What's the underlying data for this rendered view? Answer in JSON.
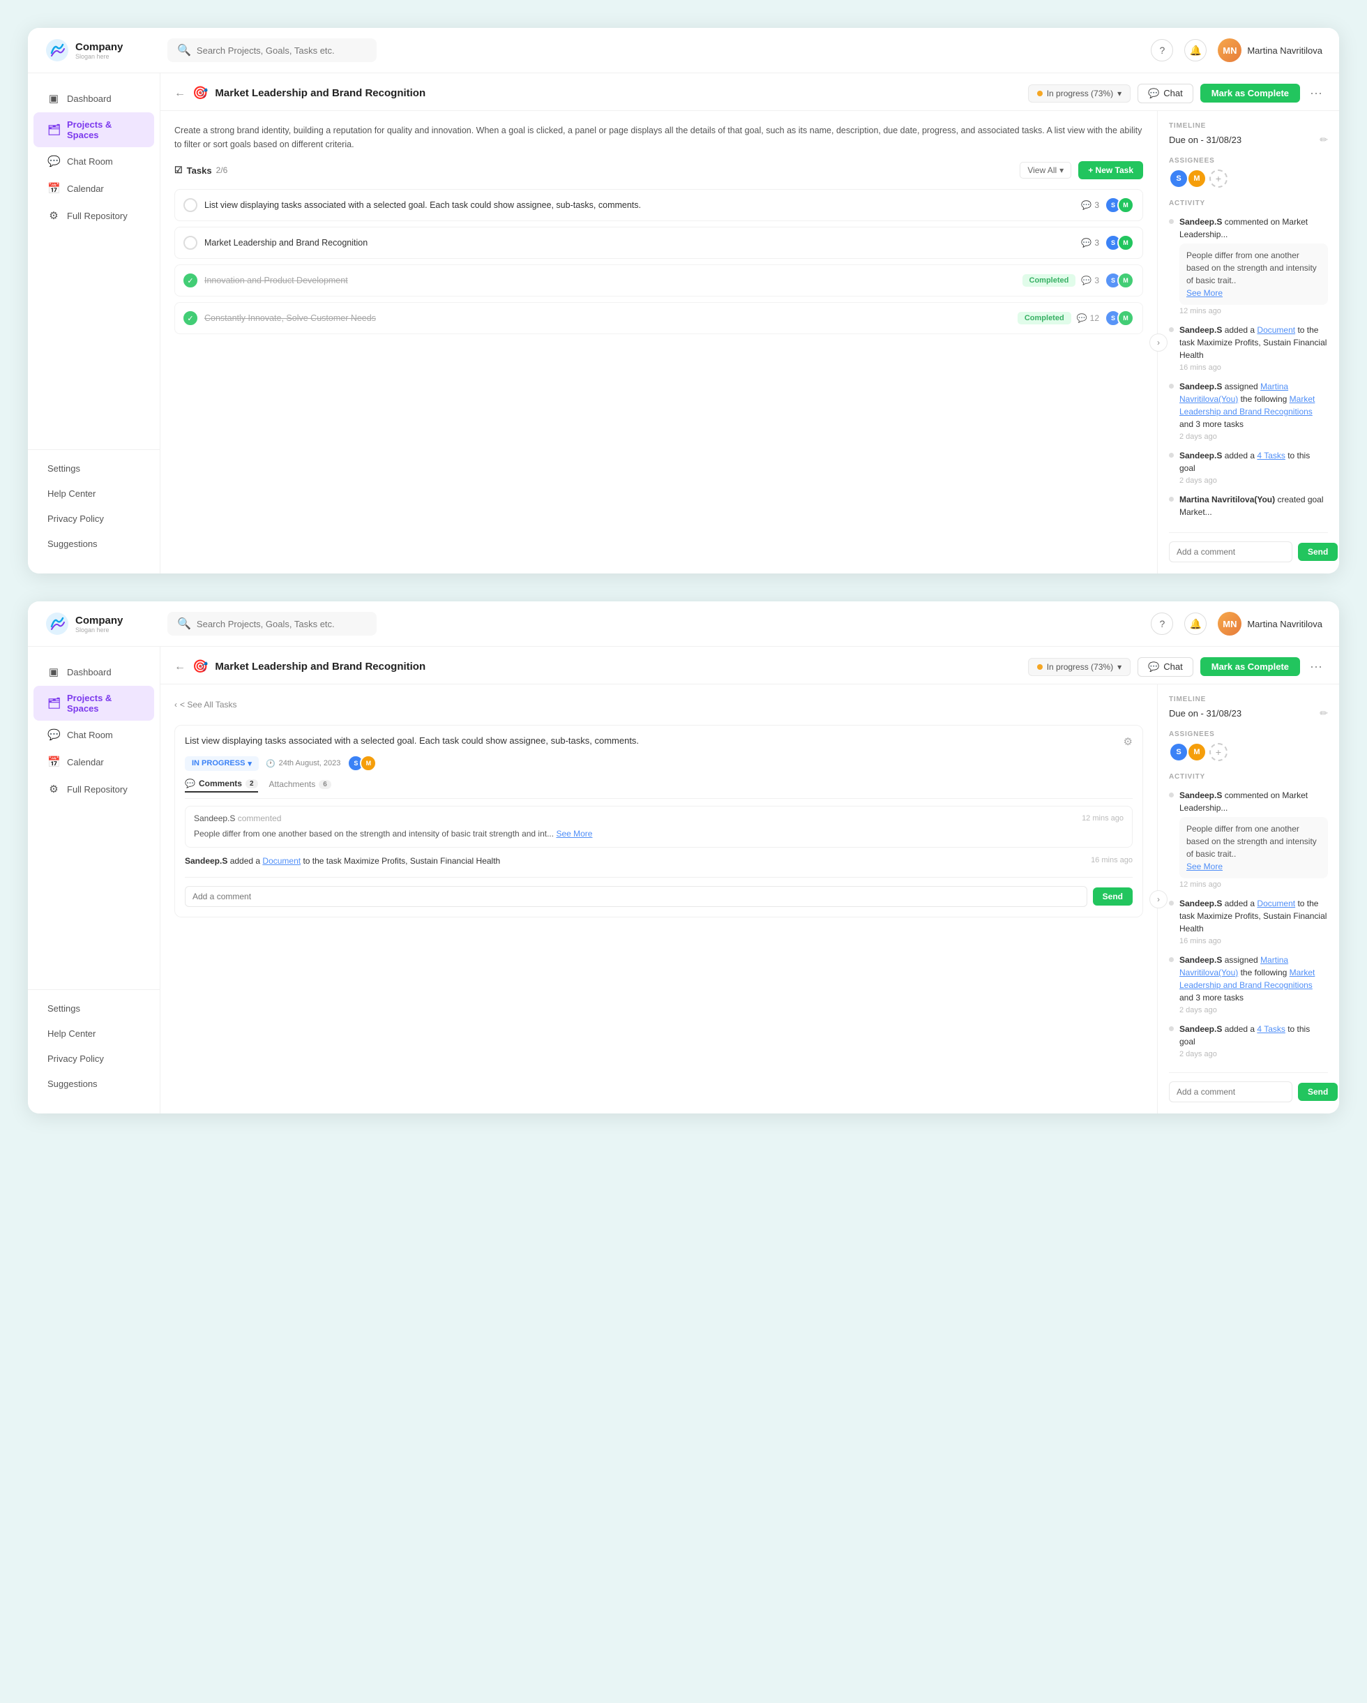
{
  "app": {
    "logo_name": "Company",
    "logo_slogan": "Slogan here",
    "search_placeholder": "Search Projects, Goals, Tasks etc."
  },
  "user": {
    "name": "Martina Navritilova",
    "initials": "MN"
  },
  "sidebar": {
    "items": [
      {
        "id": "dashboard",
        "label": "Dashboard",
        "icon": "▣"
      },
      {
        "id": "projects",
        "label": "Projects & Spaces",
        "icon": "🗂",
        "active": true
      },
      {
        "id": "chat",
        "label": "Chat Room",
        "icon": "💬"
      },
      {
        "id": "calendar",
        "label": "Calendar",
        "icon": "📅"
      },
      {
        "id": "repository",
        "label": "Full Repository",
        "icon": "⚙"
      }
    ],
    "bottom_items": [
      {
        "id": "settings",
        "label": "Settings"
      },
      {
        "id": "help",
        "label": "Help Center"
      },
      {
        "id": "privacy",
        "label": "Privacy Policy"
      },
      {
        "id": "suggestions",
        "label": "Suggestions"
      }
    ]
  },
  "goal": {
    "title": "Market Leadership and Brand Recognition",
    "description": "Create a strong brand identity, building a reputation for quality and innovation. When a goal is clicked, a panel or page displays all the details of that goal, such as its name, description, due date, progress, and associated tasks. A list view with the ability to filter or sort goals based on different criteria.",
    "status": "In progress (73%)",
    "chat_label": "Chat",
    "mark_complete_label": "Mark as Complete"
  },
  "tasks_panel1": {
    "label": "Tasks",
    "count": "2/6",
    "view_all": "View All",
    "new_task": "+ New Task",
    "items": [
      {
        "text": "List view displaying tasks associated with a selected goal. Each task could show assignee, sub-tasks, comments.",
        "done": false,
        "comments": 3,
        "completed_badge": false
      },
      {
        "text": "Market Leadership and Brand Recognition",
        "done": false,
        "comments": 3,
        "completed_badge": false
      },
      {
        "text": "Innovation and Product Development",
        "done": true,
        "comments": 3,
        "completed_badge": true,
        "badge_label": "Completed"
      },
      {
        "text": "Constantly Innovate, Solve Customer Needs",
        "done": true,
        "comments": 12,
        "completed_badge": true,
        "badge_label": "Completed"
      }
    ]
  },
  "right_panel": {
    "timeline_label": "TIMELINE",
    "timeline_value": "Due on - 31/08/23",
    "assignees_label": "ASSIGNEES",
    "activity_label": "ACTIVITY",
    "activity_items": [
      {
        "user": "Sandeep.S",
        "action": "commented on Market Leadership...",
        "has_bubble": true,
        "bubble_text": "People differ from one another based on the strength and intensity of basic trait..",
        "see_more": true,
        "time": "12 mins ago"
      },
      {
        "user": "Sandeep.S",
        "action": "added a",
        "link": "Document",
        "action2": "to the task Maximize Profits, Sustain Financial Health",
        "time": "16 mins ago"
      },
      {
        "user": "Sandeep.S",
        "action": "assigned",
        "link": "Martina Navritilova(You)",
        "action2": "the following",
        "link2": "Market Leadership and Brand Recognitions",
        "action3": "and 3 more tasks",
        "time": "2 days ago"
      },
      {
        "user": "Sandeep.S",
        "action": "added a",
        "link": "4 Tasks",
        "action2": "to this goal",
        "time": "2 days ago"
      },
      {
        "user": "Martina Navritilova(You)",
        "action": "created goal Market...",
        "time": ""
      }
    ],
    "add_comment_placeholder": "Add a comment",
    "send_label": "Send"
  },
  "panel2": {
    "see_all_tasks": "< See All Tasks",
    "task_title": "List view displaying tasks associated with a selected goal. Each task could show assignee, sub-tasks, comments.",
    "task_status": "IN PROGRESS",
    "task_date": "24th August, 2023",
    "tabs": [
      {
        "label": "Comments",
        "count": "2",
        "active": true
      },
      {
        "label": "Attachments",
        "count": "6",
        "active": false
      }
    ],
    "comments": [
      {
        "user": "Sandeep.S",
        "action": "commented",
        "time": "12 mins ago",
        "text": "People differ from one another based on the strength and intensity of basic trait strength and int...",
        "see_more": true
      }
    ],
    "activity_items": [
      {
        "user": "Sandeep.S",
        "action": "added a",
        "link": "Document",
        "action2": "to the task Maximize Profits, Sustain Financial Health",
        "time": "16 mins ago"
      }
    ],
    "add_comment_placeholder": "Add a comment",
    "send_label": "Send"
  }
}
